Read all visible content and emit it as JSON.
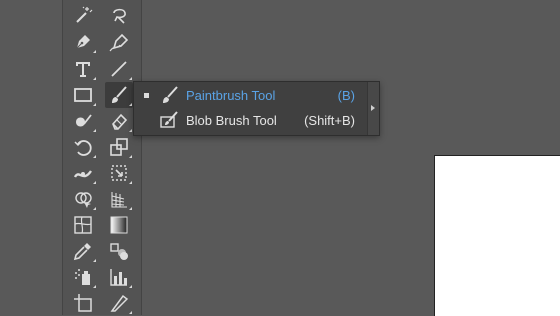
{
  "toolbar": {
    "tools": [
      {
        "name": "magic-wand-icon"
      },
      {
        "name": "lasso-icon"
      },
      {
        "name": "pen-icon"
      },
      {
        "name": "curvature-icon"
      },
      {
        "name": "type-icon"
      },
      {
        "name": "line-segment-icon"
      },
      {
        "name": "rectangle-icon"
      },
      {
        "name": "paintbrush-icon",
        "active": true
      },
      {
        "name": "shaper-icon"
      },
      {
        "name": "eraser-icon"
      },
      {
        "name": "rotate-icon"
      },
      {
        "name": "scale-icon"
      },
      {
        "name": "width-icon"
      },
      {
        "name": "free-transform-icon"
      },
      {
        "name": "shape-builder-icon"
      },
      {
        "name": "perspective-grid-icon"
      },
      {
        "name": "mesh-icon"
      },
      {
        "name": "gradient-icon"
      },
      {
        "name": "eyedropper-icon"
      },
      {
        "name": "blend-icon"
      },
      {
        "name": "symbol-sprayer-icon"
      },
      {
        "name": "column-graph-icon"
      },
      {
        "name": "artboard-icon"
      },
      {
        "name": "slice-icon"
      }
    ]
  },
  "flyout": {
    "items": [
      {
        "label": "Paintbrush Tool",
        "shortcut": "(B)",
        "current": true,
        "icon": "paintbrush-icon"
      },
      {
        "label": "Blob Brush Tool",
        "shortcut": "(Shift+B)",
        "current": false,
        "icon": "blob-brush-icon"
      }
    ]
  },
  "colors": {
    "background": "#595959",
    "panel": "#535353",
    "flyout": "#404040",
    "accent": "#5aa3e6",
    "artboard": "#ffffff"
  }
}
